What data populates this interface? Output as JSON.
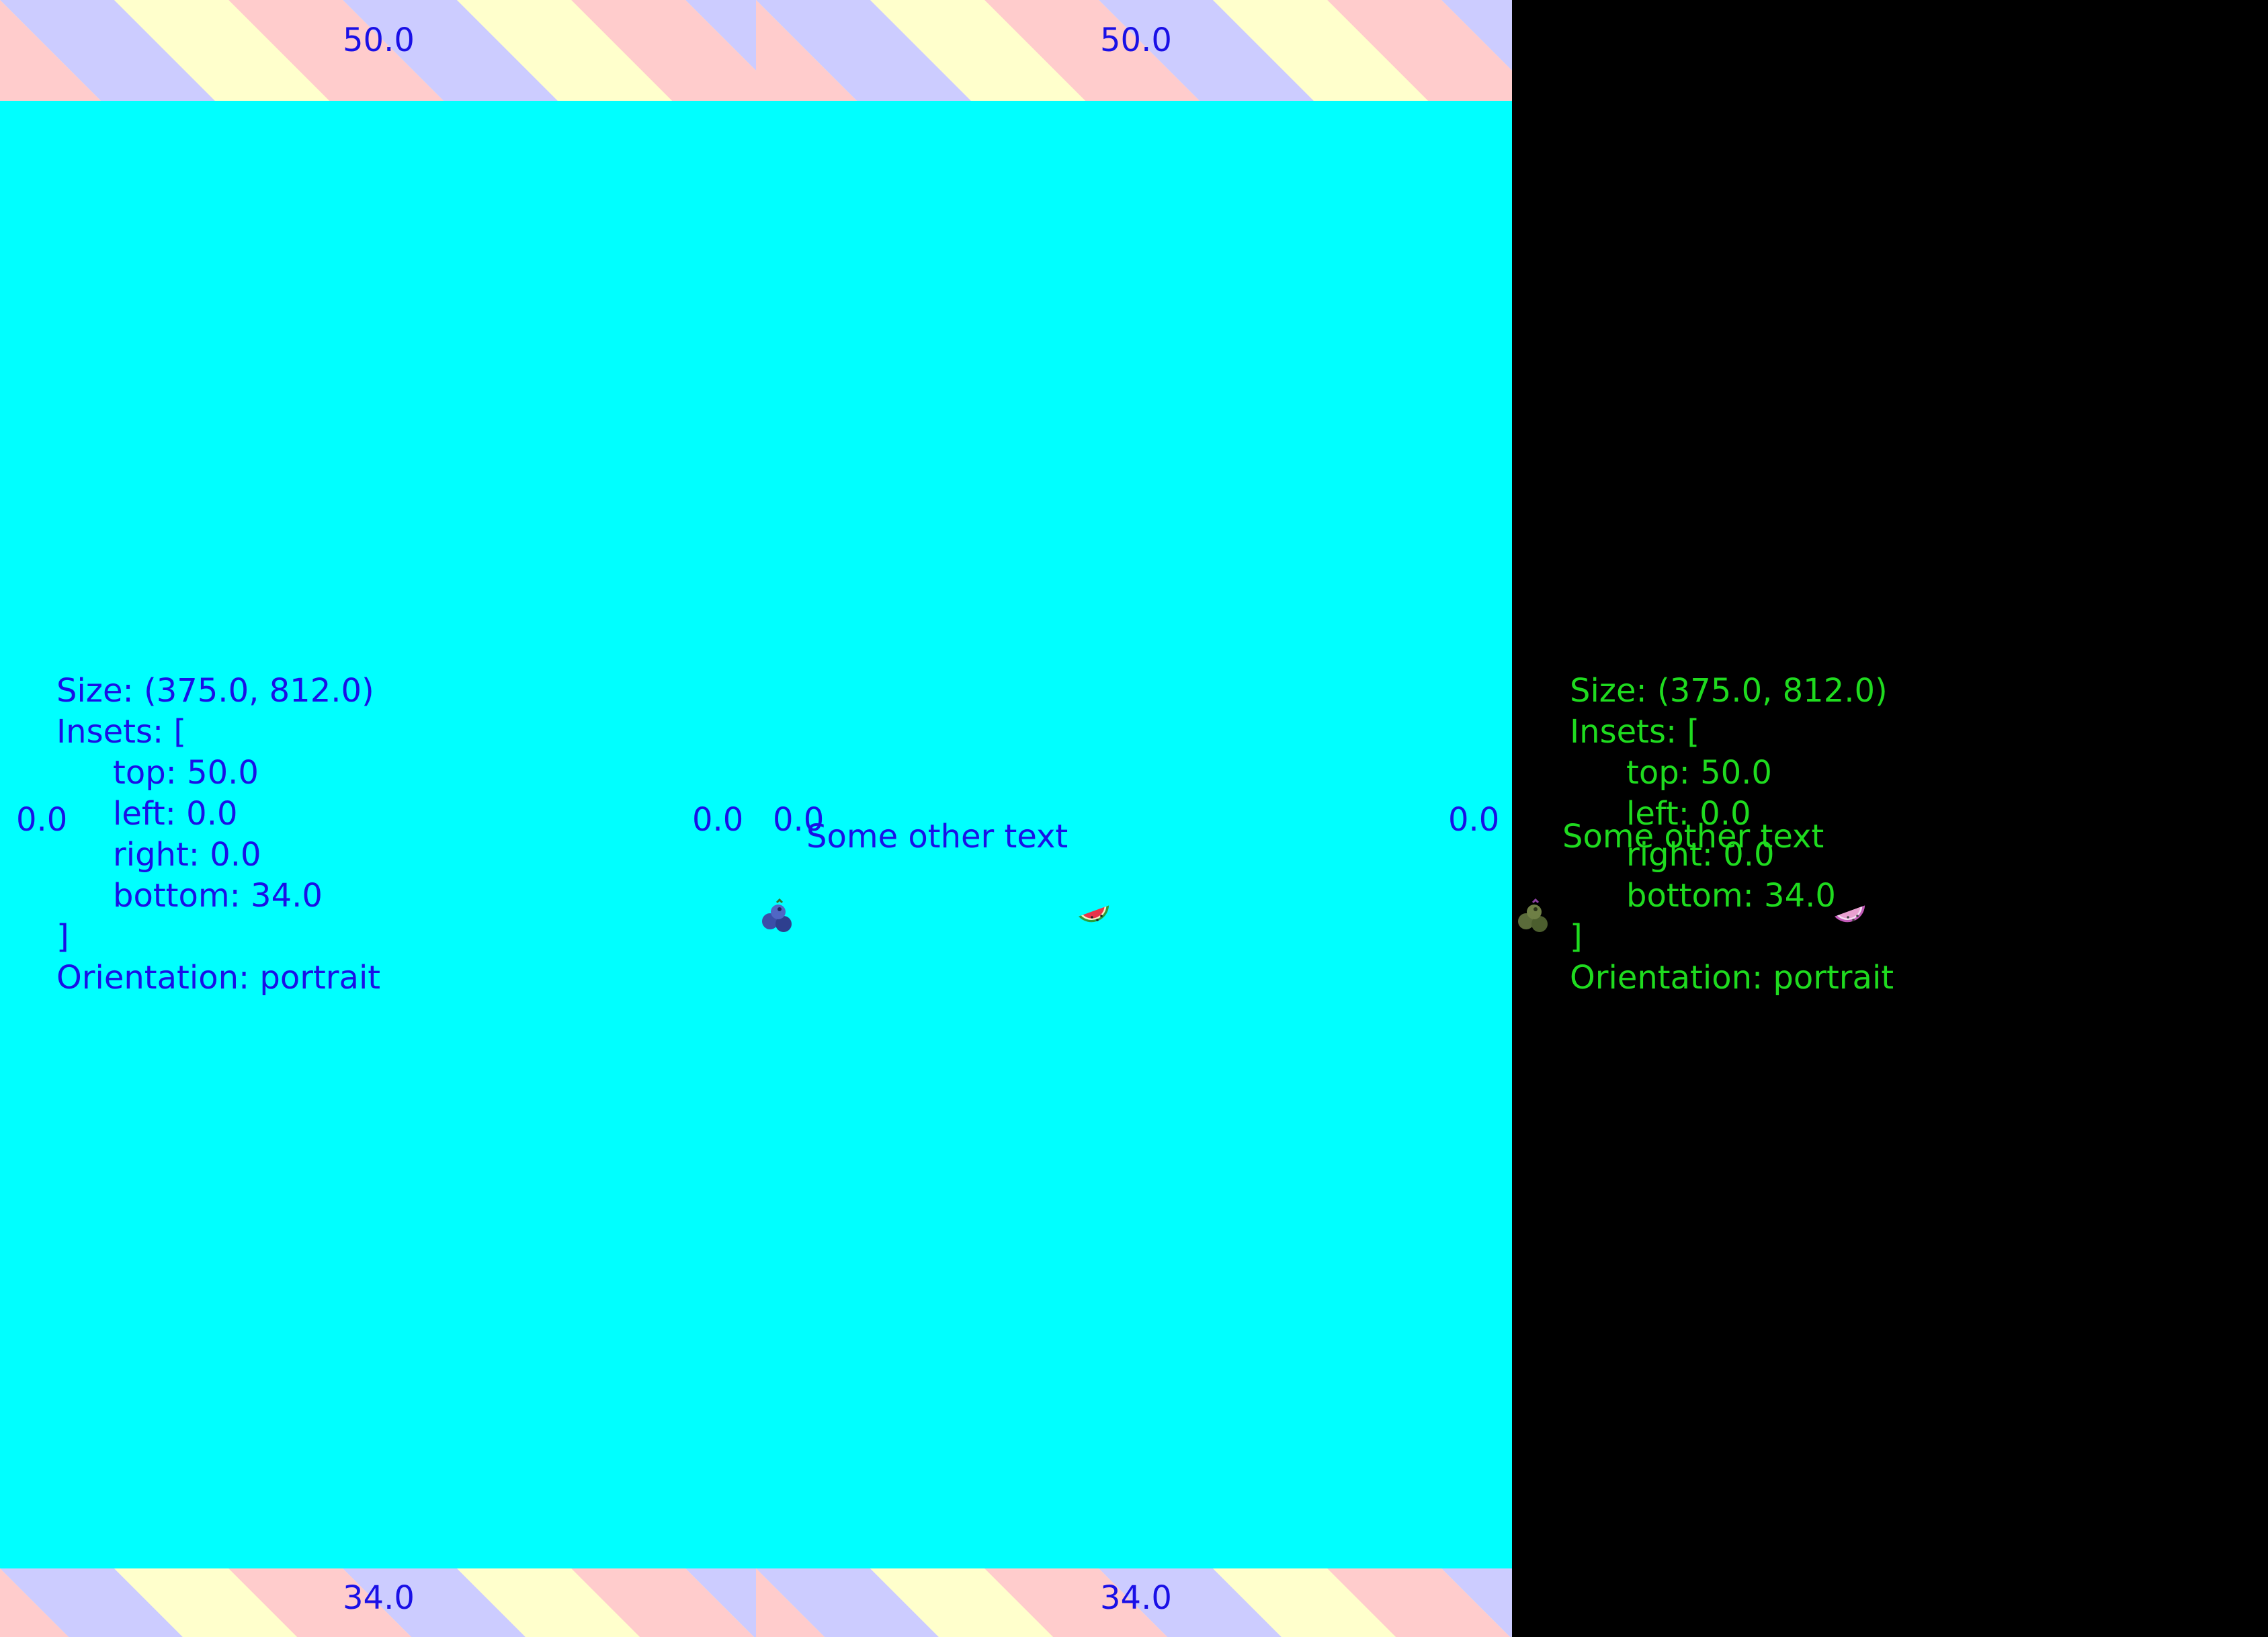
{
  "insets": {
    "top": "50.0",
    "bottom": "34.0",
    "left": "0.0",
    "right": "0.0"
  },
  "info": {
    "size_line": "Size: (375.0, 812.0)",
    "insets_open": "Insets: [",
    "top_line": "top: 50.0",
    "left_line": "left: 0.0",
    "right_line": "right: 0.0",
    "bottom_line": "bottom: 34.0",
    "insets_close": "]",
    "orientation_line": "Orientation: portrait"
  },
  "centered": {
    "text": "Some other text",
    "leading_icon": "blueberries-icon",
    "trailing_icon": "watermelon-icon"
  },
  "colors": {
    "primary_text": "#1A10E6",
    "secondary_text": "#1FDB1F",
    "content_background": "#00FFFF",
    "outer_background": "#000000",
    "stripe_pink": "#FFCCCC",
    "stripe_yellow": "#FFFFCC",
    "stripe_lavender": "#CCCCFF"
  }
}
